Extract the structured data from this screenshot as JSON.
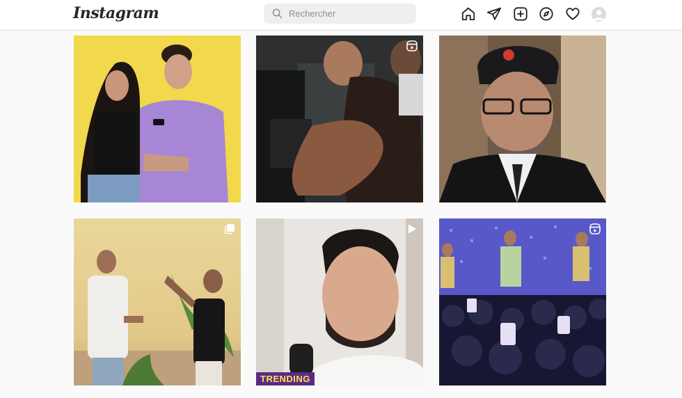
{
  "header": {
    "logo": "Instagram",
    "search": {
      "placeholder": "Rechercher"
    },
    "nav_icons": [
      "home-icon",
      "direct-icon",
      "new-post-icon",
      "explore-icon",
      "activity-icon",
      "profile-avatar"
    ]
  },
  "grid": {
    "posts": [
      {
        "type": "image",
        "badge": ""
      },
      {
        "type": "reel",
        "badge": "reel-icon"
      },
      {
        "type": "image",
        "badge": ""
      },
      {
        "type": "carousel",
        "badge": "carousel-icon"
      },
      {
        "type": "video",
        "badge": "video-icon"
      },
      {
        "type": "reel",
        "badge": "reel-icon"
      }
    ],
    "post5_overlay_text": "TRENDING"
  },
  "colors": {
    "background": "#fafafa",
    "header": "#ffffff",
    "border": "#dbdbdb",
    "search_bg": "#efefef",
    "text": "#262626"
  }
}
